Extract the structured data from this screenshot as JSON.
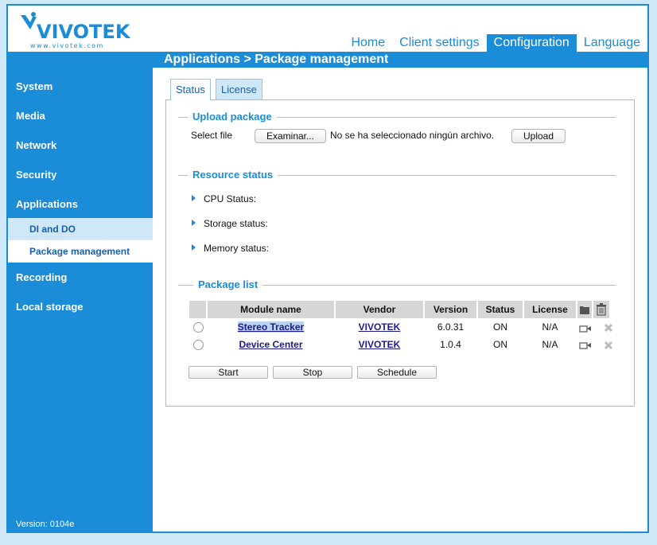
{
  "brand": {
    "logo_text": "VIVOTEK",
    "logo_sub": "www.vivotek.com"
  },
  "topnav": {
    "home": "Home",
    "client_settings": "Client settings",
    "configuration": "Configuration",
    "language": "Language"
  },
  "breadcrumb": "Applications  > Package management",
  "sidebar": {
    "system": "System",
    "media": "Media",
    "network": "Network",
    "security": "Security",
    "applications": "Applications",
    "di_do": "DI and DO",
    "package_management": "Package management",
    "recording": "Recording",
    "local_storage": "Local storage"
  },
  "version": "Version: 0104e",
  "tabs": {
    "status": "Status",
    "license": "License"
  },
  "upload": {
    "legend": "Upload package",
    "select_label": "Select file",
    "browse": "Examinar...",
    "no_file": "No se ha seleccionado ningún archivo.",
    "upload": "Upload"
  },
  "resource": {
    "legend": "Resource status",
    "cpu": "CPU Status:",
    "storage": "Storage status:",
    "memory": "Memory status:"
  },
  "packages": {
    "legend": "Package list",
    "headers": {
      "module": "Module name",
      "vendor": "Vendor",
      "version": "Version",
      "status": "Status",
      "license": "License"
    },
    "rows": [
      {
        "module": "Stereo Tracker",
        "vendor": "VIVOTEK",
        "version": "6.0.31",
        "status": "ON",
        "license": "N/A"
      },
      {
        "module": "Device Center",
        "vendor": "VIVOTEK",
        "version": "1.0.4",
        "status": "ON",
        "license": "N/A"
      }
    ],
    "buttons": {
      "start": "Start",
      "stop": "Stop",
      "schedule": "Schedule"
    }
  },
  "colors": {
    "accent": "#1a8cd8",
    "background": "#cfe8f7",
    "link": "#1a1a8c"
  }
}
